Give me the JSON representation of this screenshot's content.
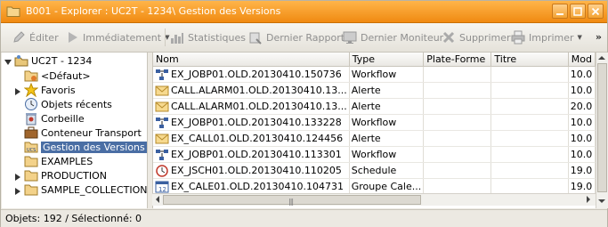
{
  "window": {
    "title": "B001 - Explorer : UC2T - 1234\\ Gestion des Versions"
  },
  "toolbar": {
    "edit": "Éditer",
    "immediate": "Immédiatement",
    "statistics": "Statistiques",
    "last_report": "Dernier Rapport",
    "last_monitor": "Dernier Moniteur",
    "delete": "Supprimer",
    "print": "Imprimer",
    "more": "»"
  },
  "tree": {
    "root": "UC2T - 1234",
    "items": [
      {
        "label": "<Défaut>"
      },
      {
        "label": "Favoris"
      },
      {
        "label": "Objets récents"
      },
      {
        "label": "Corbeille"
      },
      {
        "label": "Conteneur Transport"
      },
      {
        "label": "Gestion des Versions"
      },
      {
        "label": "EXAMPLES"
      },
      {
        "label": "PRODUCTION"
      },
      {
        "label": "SAMPLE_COLLECTION"
      }
    ]
  },
  "table": {
    "columns": [
      "Nom",
      "Type",
      "Plate-Forme",
      "Titre",
      "Mod"
    ],
    "rows": [
      {
        "name": "EX_JOBP01.OLD.20130410.150736",
        "type": "Workflow",
        "platform": "",
        "title": "",
        "mod": "10.0",
        "icon": "workflow-icon"
      },
      {
        "name": "CALL.ALARM01.OLD.20130410.13...",
        "type": "Alerte",
        "platform": "",
        "title": "",
        "mod": "10.0",
        "icon": "alert-icon"
      },
      {
        "name": "CALL.ALARM01.OLD.20130410.13...",
        "type": "Alerte",
        "platform": "",
        "title": "",
        "mod": "20.0",
        "icon": "alert-icon"
      },
      {
        "name": "EX_JOBP01.OLD.20130410.133228",
        "type": "Workflow",
        "platform": "",
        "title": "",
        "mod": "10.0",
        "icon": "workflow-icon"
      },
      {
        "name": "EX_CALL01.OLD.20130410.124456",
        "type": "Alerte",
        "platform": "",
        "title": "",
        "mod": "10.0",
        "icon": "alert-icon"
      },
      {
        "name": "EX_JOBP01.OLD.20130410.113301",
        "type": "Workflow",
        "platform": "",
        "title": "",
        "mod": "10.0",
        "icon": "workflow-icon"
      },
      {
        "name": "EX_JSCH01.OLD.20130410.110205",
        "type": "Schedule",
        "platform": "",
        "title": "",
        "mod": "19.0",
        "icon": "schedule-icon"
      },
      {
        "name": "EX_CALE01.OLD.20130410.104731",
        "type": "Groupe Cale...",
        "platform": "",
        "title": "",
        "mod": "19.0",
        "icon": "calendar-icon"
      }
    ]
  },
  "status": {
    "text": "Objets: 192  /  Sélectionné: 0"
  }
}
